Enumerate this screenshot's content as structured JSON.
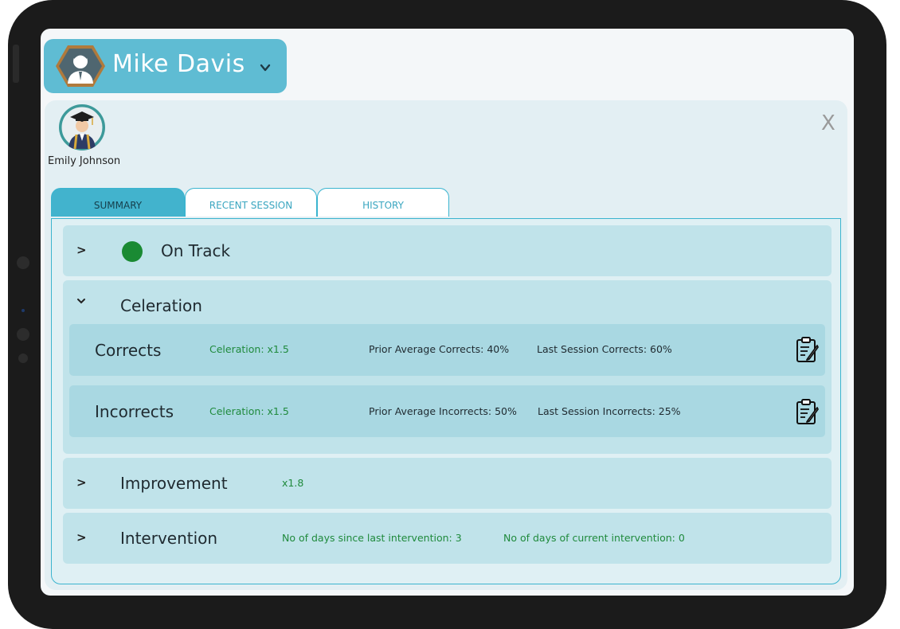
{
  "header": {
    "user_name": "Mike Davis",
    "dropdown_icon": "chevron-down-icon"
  },
  "student": {
    "name": "Emily Johnson",
    "close_label": "X"
  },
  "tabs": [
    {
      "label": "SUMMARY",
      "active": true
    },
    {
      "label": "RECENT SESSION",
      "active": false
    },
    {
      "label": "HISTORY",
      "active": false
    }
  ],
  "summary": {
    "on_track": {
      "expand": ">",
      "label": "On Track",
      "status_color": "#1a8a33"
    },
    "celeration": {
      "expand": "⌄",
      "label": "Celeration",
      "corrects": {
        "label": "Corrects",
        "celeration": "Celeration: x1.5",
        "prior": "Prior Average Corrects: 40%",
        "last": "Last Session Corrects: 60%"
      },
      "incorrects": {
        "label": "Incorrects",
        "celeration": "Celeration: x1.5",
        "prior": "Prior Average Incorrects: 50%",
        "last": "Last Session Incorrects: 25%"
      }
    },
    "improvement": {
      "expand": ">",
      "label": "Improvement",
      "value": "x1.8"
    },
    "intervention": {
      "expand": ">",
      "label": "Intervention",
      "days_since": "No of days since last intervention: 3",
      "days_current": "No of days of current intervention: 0"
    }
  },
  "colors": {
    "accent": "#5fbcd3",
    "tab_border": "#3bb4cf",
    "green_text": "#1f8a3c"
  }
}
